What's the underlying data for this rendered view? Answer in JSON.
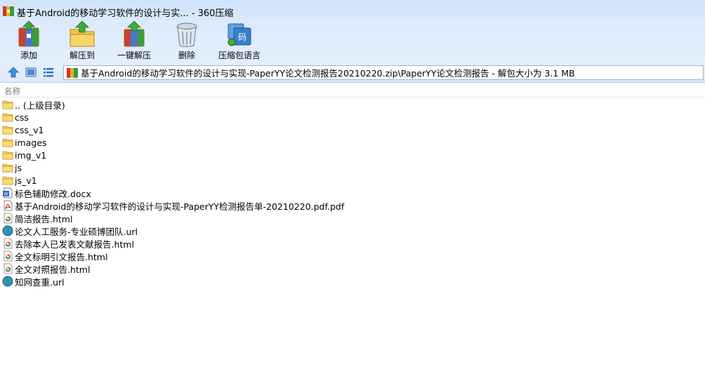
{
  "window": {
    "title": "基于Android的移动学习软件的设计与实... - 360压缩"
  },
  "toolbar": {
    "add_label": "添加",
    "extract_label": "解压到",
    "one_click_label": "一键解压",
    "delete_label": "删除",
    "encoding_label": "压缩包语言"
  },
  "nav": {
    "path": "基于Android的移动学习软件的设计与实现-PaperYY论文检测报告20210220.zip\\PaperYY论文检测报告 - 解包大小为 3.1 MB"
  },
  "list": {
    "column_name": "名称",
    "items": [
      {
        "name": ".. (上级目录)",
        "icon": "folder-icon"
      },
      {
        "name": "css",
        "icon": "folder-icon"
      },
      {
        "name": "css_v1",
        "icon": "folder-icon"
      },
      {
        "name": "images",
        "icon": "folder-icon"
      },
      {
        "name": "img_v1",
        "icon": "folder-icon"
      },
      {
        "name": "js",
        "icon": "folder-icon"
      },
      {
        "name": "js_v1",
        "icon": "folder-icon"
      },
      {
        "name": "标色辅助修改.docx",
        "icon": "word-doc-icon"
      },
      {
        "name": "基于Android的移动学习软件的设计与实现-PaperYY检测报告单-20210220.pdf.pdf",
        "icon": "pdf-icon"
      },
      {
        "name": "简洁报告.html",
        "icon": "html-browser-icon"
      },
      {
        "name": "论文人工服务-专业硕博团队.url",
        "icon": "globe-icon"
      },
      {
        "name": "去除本人已发表文献报告.html",
        "icon": "html-browser-icon"
      },
      {
        "name": "全文标明引文报告.html",
        "icon": "html-browser-icon"
      },
      {
        "name": "全文对照报告.html",
        "icon": "html-browser-icon"
      },
      {
        "name": "知网查重.url",
        "icon": "globe-icon"
      }
    ]
  }
}
